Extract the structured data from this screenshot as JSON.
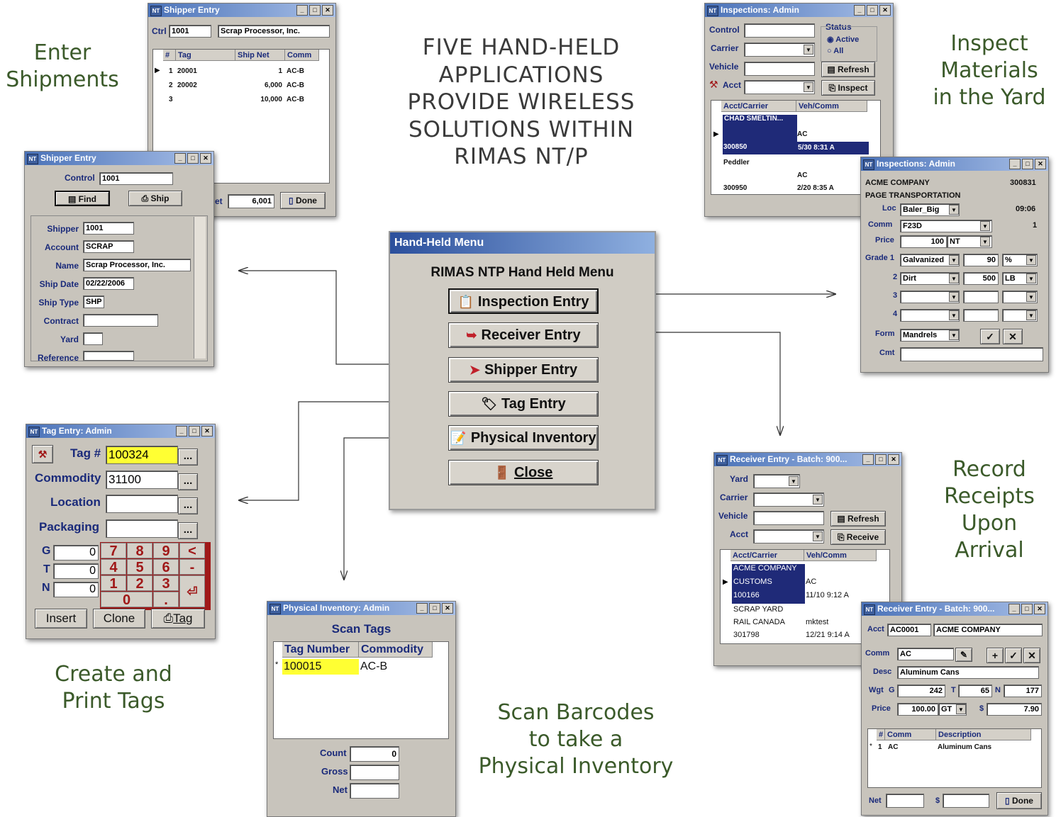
{
  "headline": [
    "FIVE HAND-HELD",
    "APPLICATIONS",
    "PROVIDE WIRELESS",
    "SOLUTIONS WITHIN",
    "RIMAS NT/P"
  ],
  "captions": {
    "enter_shipments": [
      "Enter",
      "Shipments"
    ],
    "inspect": [
      "Inspect",
      "Materials",
      "in the Yard"
    ],
    "record": [
      "Record",
      "Receipts",
      "Upon",
      "Arrival"
    ],
    "create_tags": [
      "Create and",
      "Print Tags"
    ],
    "scan": [
      "Scan Barcodes",
      "to take a",
      "Physical Inventory"
    ]
  },
  "menu": {
    "title": "Hand-Held Menu",
    "heading": "RIMAS NTP Hand Held Menu",
    "buttons": [
      "Inspection Entry",
      "Receiver Entry",
      "Shipper Entry",
      "Tag Entry",
      "Physical Inventory",
      "Close"
    ]
  },
  "shipper_back": {
    "title": "Shipper Entry",
    "ctrl_label": "Ctrl",
    "ctrl": "1001",
    "name": "Scrap Processor, Inc.",
    "headers": [
      "#",
      "Tag",
      "Ship Net",
      "Comm"
    ],
    "rows": [
      [
        "1",
        "20001",
        "1",
        "AC-B"
      ],
      [
        "2",
        "20002",
        "6,000",
        "AC-B"
      ],
      [
        "3",
        "",
        "10,000",
        "AC-B"
      ]
    ],
    "net_label": "et",
    "net": "6,001",
    "done": "Done"
  },
  "shipper_front": {
    "title": "Shipper Entry",
    "control_label": "Control",
    "control": "1001",
    "find": "Find",
    "ship": "Ship",
    "fields": [
      {
        "label": "Shipper",
        "value": "1001"
      },
      {
        "label": "Account",
        "value": "SCRAP"
      },
      {
        "label": "Name",
        "value": "Scrap Processor, Inc."
      },
      {
        "label": "Ship Date",
        "value": "02/22/2006"
      },
      {
        "label": "Ship Type",
        "value": "SHP"
      },
      {
        "label": "Contract",
        "value": ""
      },
      {
        "label": "Yard",
        "value": ""
      },
      {
        "label": "Reference",
        "value": ""
      }
    ]
  },
  "insp_back": {
    "title": "Inspections: Admin",
    "labels": [
      "Control",
      "Carrier",
      "Vehicle",
      "Acct"
    ],
    "status_label": "Status",
    "active": "Active",
    "all": "All",
    "refresh": "Refresh",
    "inspect": "Inspect",
    "headers": [
      "Acct/Carrier",
      "Veh/Comm"
    ],
    "rows": [
      [
        "CHAD SMELTIN...",
        ""
      ],
      [
        "",
        "AC"
      ],
      [
        "300850",
        "5/30 8:31 A"
      ],
      [
        "Peddler",
        ""
      ],
      [
        "",
        "AC"
      ],
      [
        "300950",
        "2/20 8:35 A"
      ]
    ]
  },
  "insp_front": {
    "title": "Inspections: Admin",
    "company": "ACME COMPANY",
    "number": "300831",
    "company2": "PAGE TRANSPORTATION",
    "loc_label": "Loc",
    "loc": "Baler_Big",
    "time": "09:06",
    "comm_label": "Comm",
    "comm": "F23D",
    "one": "1",
    "price_label": "Price",
    "price": "100",
    "price_unit": "NT",
    "grade_label": "Grade 1",
    "grades": [
      {
        "n": "",
        "name": "Galvanized",
        "val": "90",
        "unit": "%"
      },
      {
        "n": "2",
        "name": "Dirt",
        "val": "500",
        "unit": "LB"
      },
      {
        "n": "3",
        "name": "",
        "val": "",
        "unit": ""
      },
      {
        "n": "4",
        "name": "",
        "val": "",
        "unit": ""
      }
    ],
    "form_label": "Form",
    "form": "Mandrels",
    "cmt_label": "Cmt"
  },
  "tag": {
    "title": "Tag Entry: Admin",
    "tag_label": "Tag #",
    "tag": "100324",
    "commodity_label": "Commodity",
    "commodity": "31100",
    "location_label": "Location",
    "packaging_label": "Packaging",
    "g": "G",
    "t": "T",
    "n": "N",
    "gv": "0",
    "tv": "0",
    "nv": "0",
    "keys": [
      "7",
      "8",
      "9",
      "<",
      "4",
      "5",
      "6",
      "-",
      "1",
      "2",
      "3",
      "0",
      "."
    ],
    "insert": "Insert",
    "clone": "Clone",
    "tagbtn": "Tag",
    "ellipsis": "..."
  },
  "physical": {
    "title": "Physical Inventory: Admin",
    "heading": "Scan Tags",
    "headers": [
      "Tag Number",
      "Commodity"
    ],
    "row": [
      "100015",
      "AC-B"
    ],
    "count_label": "Count",
    "count": "0",
    "gross_label": "Gross",
    "net_label": "Net"
  },
  "recv_back": {
    "title": "Receiver Entry - Batch: 900...",
    "labels": [
      "Yard",
      "Carrier",
      "Vehicle",
      "Acct"
    ],
    "refresh": "Refresh",
    "receive": "Receive",
    "headers": [
      "Acct/Carrier",
      "Veh/Comm"
    ],
    "rows": [
      [
        "ACME COMPANY",
        ""
      ],
      [
        "CUSTOMS",
        "AC"
      ],
      [
        "100166",
        "11/10 9:12 A"
      ],
      [
        "SCRAP YARD",
        ""
      ],
      [
        "RAIL CANADA",
        "mktest"
      ],
      [
        "301798",
        "12/21 9:14 A"
      ]
    ]
  },
  "recv_front": {
    "title": "Receiver Entry - Batch: 900...",
    "acct_label": "Acct",
    "acct": "AC0001",
    "acct_name": "ACME COMPANY",
    "comm_label": "Comm",
    "comm": "AC",
    "desc_label": "Desc",
    "desc": "Aluminum Cans",
    "wgt_label": "Wgt",
    "g": "G",
    "gv": "242",
    "t": "T",
    "tv": "65",
    "n": "N",
    "nv": "177",
    "price_label": "Price",
    "price": "100.00",
    "unit": "GT",
    "dollar": "$",
    "amount": "7.90",
    "headers": [
      "#",
      "Comm",
      "Description"
    ],
    "row": [
      "1",
      "AC",
      "Aluminum Cans"
    ],
    "net_label": "Net",
    "done": "Done"
  }
}
